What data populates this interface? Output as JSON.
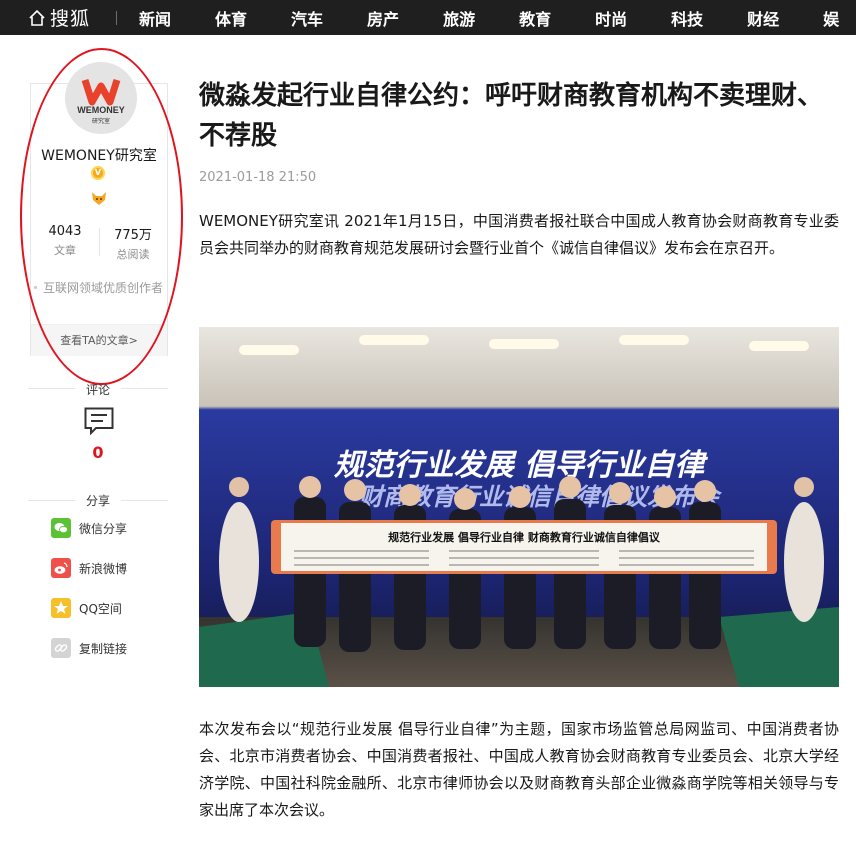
{
  "header": {
    "logo_text": "搜狐",
    "nav": [
      "新闻",
      "体育",
      "汽车",
      "房产",
      "旅游",
      "教育",
      "时尚",
      "科技",
      "财经",
      "娱"
    ]
  },
  "author": {
    "avatar_text_top": "WEMONEY",
    "avatar_text_bottom": "研究室",
    "name": "WEMONEY研究室",
    "articles_count": "4043",
    "articles_label": "文章",
    "reads_count": "775万",
    "reads_label": "总阅读",
    "description": "互联网领域优质创作者",
    "view_articles": "查看TA的文章>"
  },
  "comments": {
    "title": "评论",
    "count": "0"
  },
  "share": {
    "title": "分享",
    "items": [
      {
        "label": "微信分享",
        "icon": "wechat-icon",
        "color": "#5bc236"
      },
      {
        "label": "新浪微博",
        "icon": "weibo-icon",
        "color": "#f0504a"
      },
      {
        "label": "QQ空间",
        "icon": "qzone-icon",
        "color": "#f6c02b"
      },
      {
        "label": "复制链接",
        "icon": "link-icon",
        "color": "#c9c9c9"
      }
    ]
  },
  "article": {
    "title": "微淼发起行业自律公约：呼吁财商教育机构不卖理财、不荐股",
    "date": "2021-01-18 21:50",
    "paragraph_1": "WEMONEY研究室讯 2021年1月15日，中国消费者报社联合中国成人教育协会财商教育专业委员会共同举办的财商教育规范发展研讨会暨行业首个《诚信自律倡议》发布会在京召开。",
    "photo": {
      "backdrop_line_1": "规范行业发展  倡导行业自律",
      "backdrop_line_2": "财商教育行业诚信自律倡议发布会",
      "banner_text": "规范行业发展  倡导行业自律  财商教育行业诚信自律倡议"
    },
    "paragraph_2": "本次发布会以“规范行业发展 倡导行业自律”为主题，国家市场监管总局网监司、中国消费者协会、北京市消费者协会、中国消费者报社、中国成人教育协会财商教育专业委员会、北京大学经济学院、中国社科院金融所、北京市律师协会以及财商教育头部企业微淼商学院等相关领导与专家出席了本次会议。"
  },
  "colors": {
    "nav_bg": "#1f1f1f",
    "annotation_red": "#e0141e",
    "comment_count": "#e0141e"
  }
}
